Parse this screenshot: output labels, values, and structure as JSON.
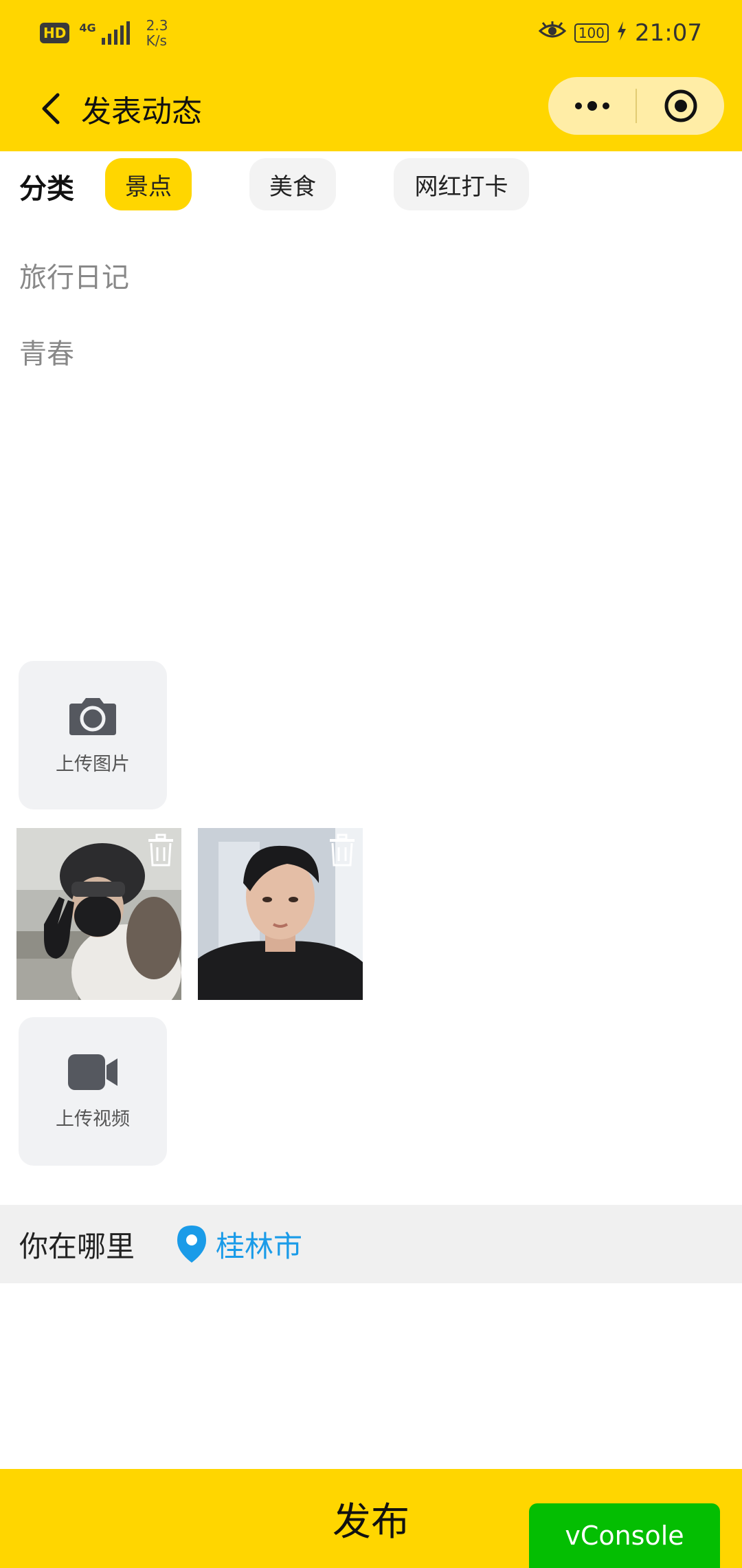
{
  "status_bar": {
    "hd_badge": "HD",
    "network_type": "4G",
    "speed_value": "2.3",
    "speed_unit": "K/s",
    "battery": "100",
    "time": "21:07",
    "icons": [
      "eye-icon",
      "battery-icon",
      "charging-icon",
      "signal-icon"
    ]
  },
  "header": {
    "title": "发表动态",
    "icons": [
      "back-arrow-icon",
      "more-dots-icon",
      "record-target-icon"
    ]
  },
  "category": {
    "label": "分类",
    "options": [
      "景点",
      "美食",
      "网红打卡"
    ],
    "selected": "景点"
  },
  "title_input": {
    "value": "旅行日记"
  },
  "content_input": {
    "value": "青春"
  },
  "upload_image": {
    "label": "上传图片",
    "icon": "camera-icon"
  },
  "photos": [
    {
      "alt": "selfie-helmet-mask",
      "icon": "trash-icon"
    },
    {
      "alt": "selfie-portrait",
      "icon": "trash-icon"
    }
  ],
  "upload_video": {
    "label": "上传视频",
    "icon": "video-camera-icon"
  },
  "location": {
    "label": "你在哪里",
    "value": "桂林市",
    "icon": "location-pin-icon"
  },
  "publish": {
    "label": "发布"
  },
  "vconsole": {
    "label": "vConsole"
  },
  "colors": {
    "brand_yellow": "#FFD600",
    "chip_inactive": "#f3f3f3",
    "tile_bg": "#f1f2f4",
    "location_blue": "#1a9be8",
    "vconsole_green": "#04BE02"
  }
}
